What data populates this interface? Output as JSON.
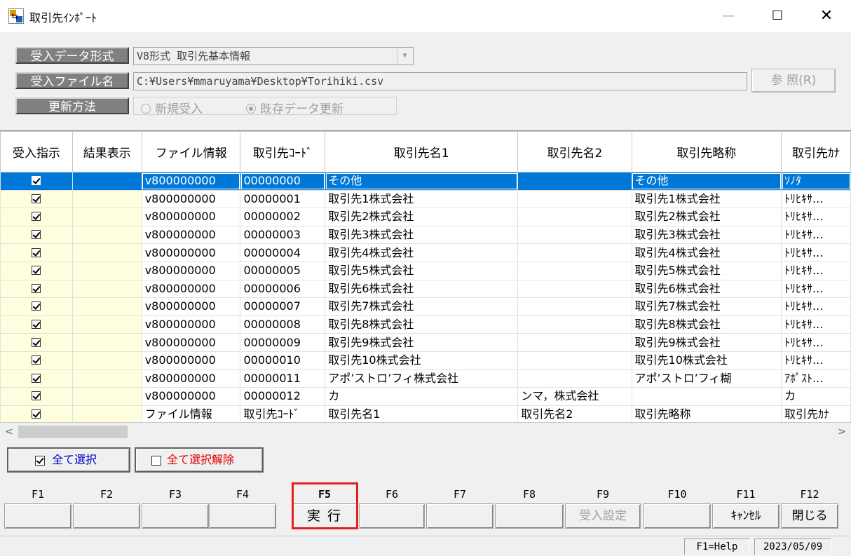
{
  "window": {
    "title": "取引先ｲﾝﾎﾟｰﾄ",
    "min_glyph": "—",
    "max_glyph": "☐",
    "close_glyph": "✕"
  },
  "settings": {
    "format_label": "受入データ形式",
    "format_value": "V8形式 取引先基本情報",
    "file_label": "受入ファイル名",
    "file_value": "C:¥Users¥mmaruyama¥Desktop¥Torihiki.csv",
    "browse_button": "参 照(R)",
    "update_label": "更新方法",
    "radio_new": "新規受入",
    "radio_existing": "既存データ更新",
    "selected_radio": "既存データ更新"
  },
  "grid": {
    "columns": [
      "受入指示",
      "結果表示",
      "ファイル情報",
      "取引先ｺｰﾄﾞ",
      "取引先名1",
      "取引先名2",
      "取引先略称",
      "取引先ｶﾅ"
    ],
    "rows": [
      {
        "checked": true,
        "result": "",
        "file_info": "v800000000",
        "code": "00000000",
        "name1": "その他",
        "name2": "",
        "short": "その他",
        "kana": "ｿﾉﾀ",
        "selected": true
      },
      {
        "checked": true,
        "result": "",
        "file_info": "v800000000",
        "code": "00000001",
        "name1": "取引先1株式会社",
        "name2": "",
        "short": "取引先1株式会社",
        "kana": "ﾄﾘﾋｷｻ..."
      },
      {
        "checked": true,
        "result": "",
        "file_info": "v800000000",
        "code": "00000002",
        "name1": "取引先2株式会社",
        "name2": "",
        "short": "取引先2株式会社",
        "kana": "ﾄﾘﾋｷｻ..."
      },
      {
        "checked": true,
        "result": "",
        "file_info": "v800000000",
        "code": "00000003",
        "name1": "取引先3株式会社",
        "name2": "",
        "short": "取引先3株式会社",
        "kana": "ﾄﾘﾋｷｻ..."
      },
      {
        "checked": true,
        "result": "",
        "file_info": "v800000000",
        "code": "00000004",
        "name1": "取引先4株式会社",
        "name2": "",
        "short": "取引先4株式会社",
        "kana": "ﾄﾘﾋｷｻ..."
      },
      {
        "checked": true,
        "result": "",
        "file_info": "v800000000",
        "code": "00000005",
        "name1": "取引先5株式会社",
        "name2": "",
        "short": "取引先5株式会社",
        "kana": "ﾄﾘﾋｷｻ..."
      },
      {
        "checked": true,
        "result": "",
        "file_info": "v800000000",
        "code": "00000006",
        "name1": "取引先6株式会社",
        "name2": "",
        "short": "取引先6株式会社",
        "kana": "ﾄﾘﾋｷｻ..."
      },
      {
        "checked": true,
        "result": "",
        "file_info": "v800000000",
        "code": "00000007",
        "name1": "取引先7株式会社",
        "name2": "",
        "short": "取引先7株式会社",
        "kana": "ﾄﾘﾋｷｻ..."
      },
      {
        "checked": true,
        "result": "",
        "file_info": "v800000000",
        "code": "00000008",
        "name1": "取引先8株式会社",
        "name2": "",
        "short": "取引先8株式会社",
        "kana": "ﾄﾘﾋｷｻ..."
      },
      {
        "checked": true,
        "result": "",
        "file_info": "v800000000",
        "code": "00000009",
        "name1": "取引先9株式会社",
        "name2": "",
        "short": "取引先9株式会社",
        "kana": "ﾄﾘﾋｷｻ..."
      },
      {
        "checked": true,
        "result": "",
        "file_info": "v800000000",
        "code": "00000010",
        "name1": "取引先10株式会社",
        "name2": "",
        "short": "取引先10株式会社",
        "kana": "ﾄﾘﾋｷｻ..."
      },
      {
        "checked": true,
        "result": "",
        "file_info": "v800000000",
        "code": "00000011",
        "name1": "アポ’ストロ’フィ株式会社",
        "name2": "",
        "short": "アポ’ストロ’フィ糊",
        "kana": "ｱﾎﾟｽﾄ..."
      },
      {
        "checked": true,
        "result": "",
        "file_info": "v800000000",
        "code": "00000012",
        "name1": "カ",
        "name2": "ンマ，株式会社",
        "short": "",
        "kana": "カ"
      },
      {
        "checked": true,
        "result": "",
        "file_info": "ファイル情報",
        "code": "取引先ｺｰﾄﾞ",
        "name1": "取引先名1",
        "name2": "取引先名2",
        "short": "取引先略称",
        "kana": "取引先ｶﾅ"
      }
    ]
  },
  "scrollbar": {
    "left_glyph": "<",
    "right_glyph": ">"
  },
  "select_buttons": {
    "select_all": "全て選択",
    "deselect_all": "全て選択解除",
    "select_all_color": "#0000c0",
    "deselect_all_color": "#e00000"
  },
  "function_keys": [
    {
      "key": "F1",
      "label": ""
    },
    {
      "key": "F2",
      "label": ""
    },
    {
      "key": "F3",
      "label": ""
    },
    {
      "key": "F4",
      "label": ""
    },
    {
      "key": "F5",
      "label": "実 行"
    },
    {
      "key": "F6",
      "label": ""
    },
    {
      "key": "F7",
      "label": ""
    },
    {
      "key": "F8",
      "label": ""
    },
    {
      "key": "F9",
      "label": "受入設定"
    },
    {
      "key": "F10",
      "label": ""
    },
    {
      "key": "F11",
      "label": "ｷｬﾝｾﾙ"
    },
    {
      "key": "F12",
      "label": "閉じる"
    }
  ],
  "status_bar": {
    "help": "F1=Help",
    "date": "2023/05/09"
  },
  "colors": {
    "selection": "#0078d7",
    "check_column_bg": "#ffffe0",
    "highlight_border": "#e02020"
  }
}
